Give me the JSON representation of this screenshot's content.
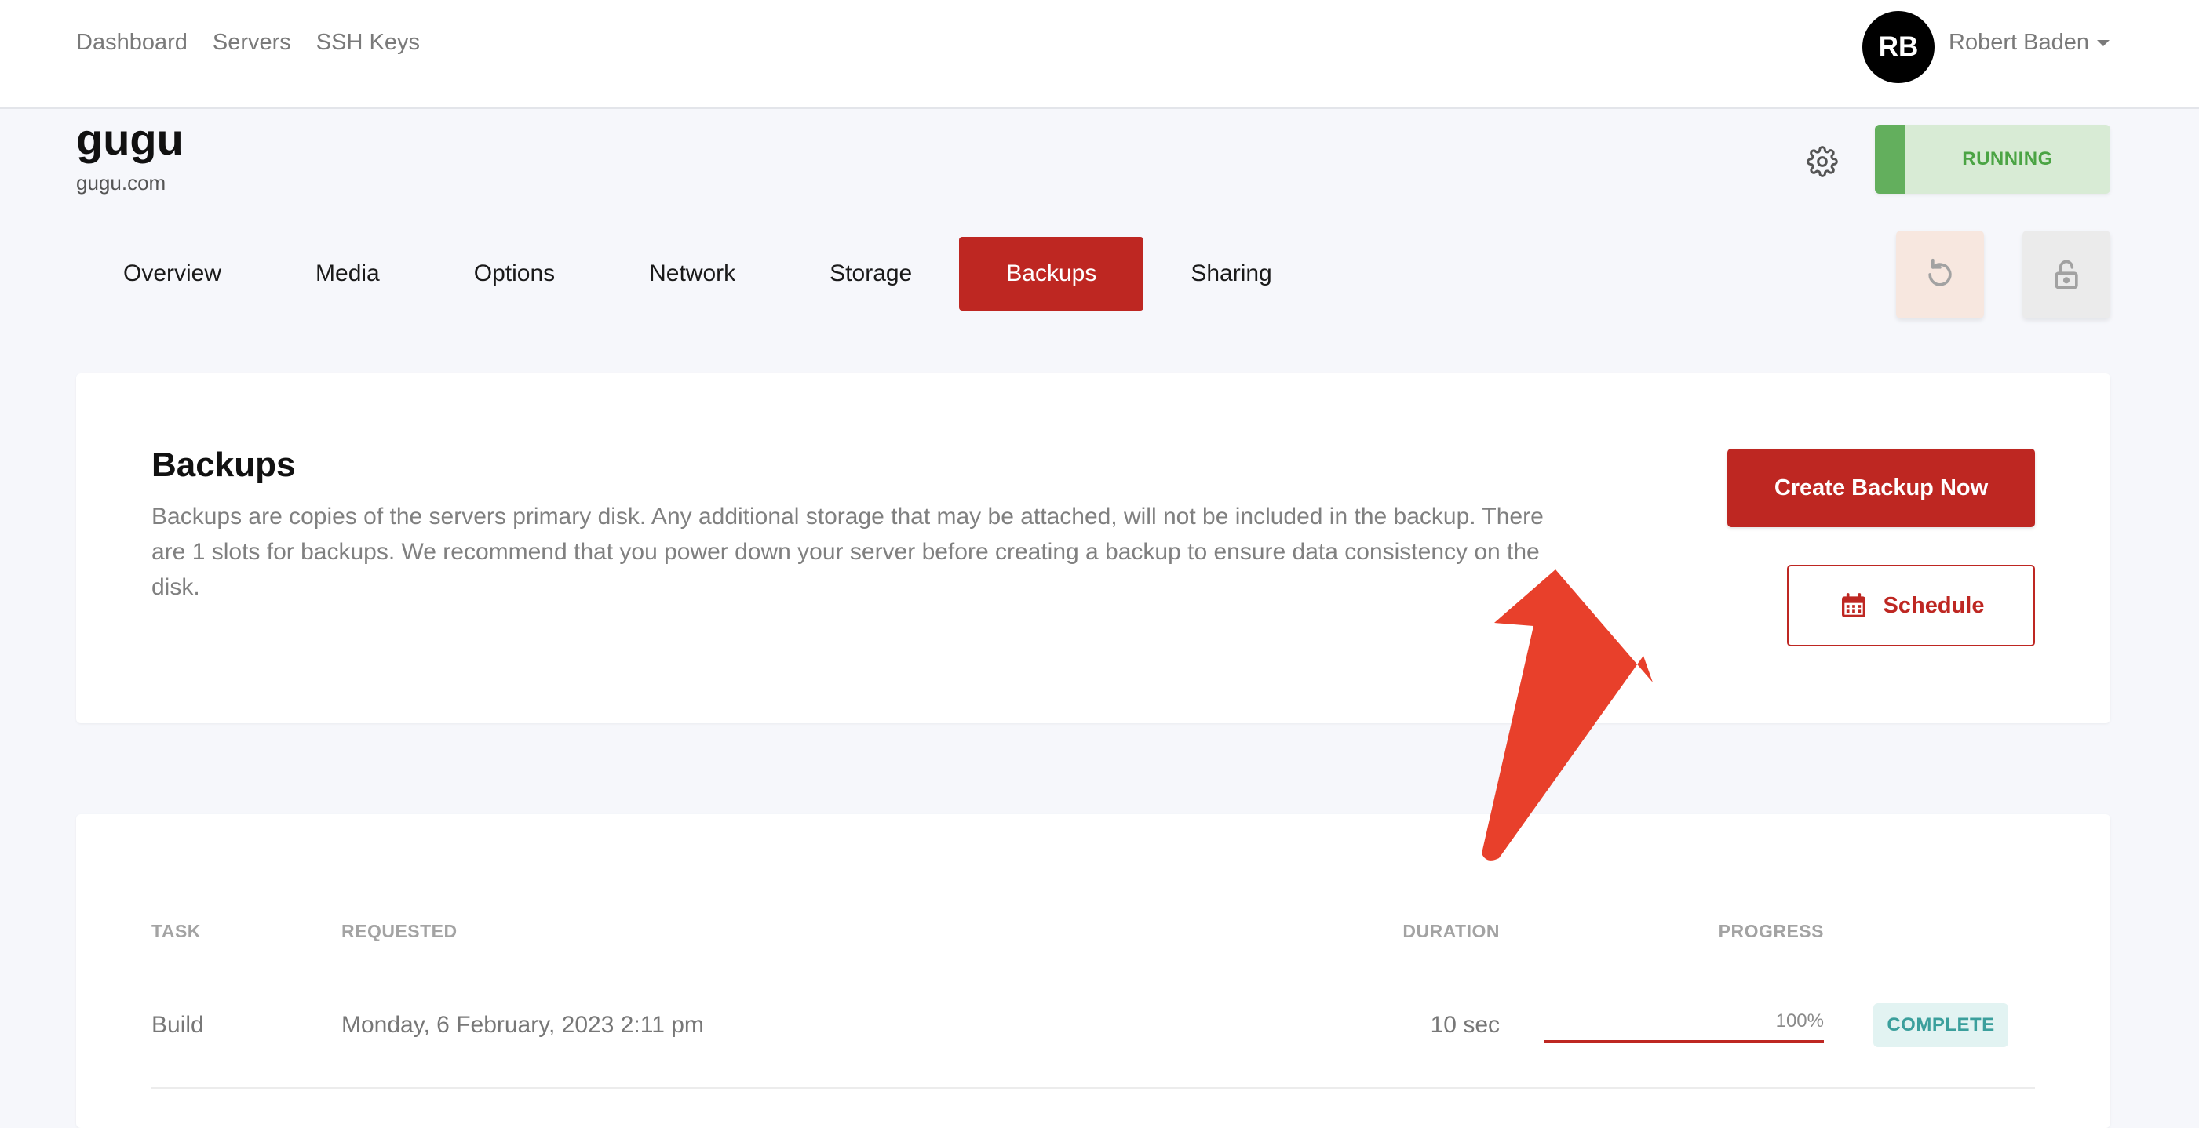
{
  "topnav": {
    "items": [
      {
        "label": "Dashboard"
      },
      {
        "label": "Servers"
      },
      {
        "label": "SSH Keys"
      }
    ]
  },
  "user": {
    "initials": "RB",
    "name": "Robert Baden"
  },
  "server": {
    "name": "gugu",
    "domain": "gugu.com",
    "status": "RUNNING"
  },
  "tabs": [
    {
      "label": "Overview"
    },
    {
      "label": "Media"
    },
    {
      "label": "Options"
    },
    {
      "label": "Network"
    },
    {
      "label": "Storage"
    },
    {
      "label": "Backups",
      "active": true
    },
    {
      "label": "Sharing"
    }
  ],
  "backups": {
    "title": "Backups",
    "description": "Backups are copies of the servers primary disk. Any additional storage that may be attached, will not be included in the backup. There are 1 slots for backups. We recommend that you power down your server before creating a backup to ensure data consistency on the disk.",
    "create_label": "Create Backup Now",
    "schedule_label": "Schedule"
  },
  "table": {
    "headers": {
      "task": "TASK",
      "requested": "REQUESTED",
      "duration": "DURATION",
      "progress": "PROGRESS"
    },
    "rows": [
      {
        "task": "Build",
        "requested": "Monday, 6 February, 2023 2:11 pm",
        "duration": "10 sec",
        "progress": "100%",
        "progress_value": 1.0,
        "status": "COMPLETE"
      }
    ]
  },
  "colors": {
    "accent": "#be2722",
    "running_bg": "#d8ebd5",
    "running_strip": "#63af5d",
    "complete_text": "#3b9f9c",
    "annotation_arrow": "#e8402b"
  },
  "icons": [
    "gear-icon",
    "restart-icon",
    "unlock-icon",
    "calendar-icon",
    "caret-down-icon",
    "annotation-arrow"
  ]
}
